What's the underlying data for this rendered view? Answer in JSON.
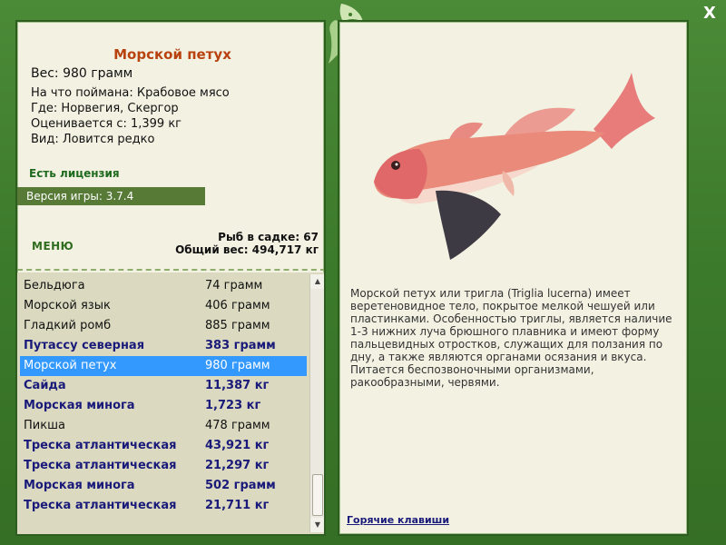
{
  "fish": {
    "title": "Морской петух",
    "weight_line": "Вес: 980 грамм",
    "details": [
      "На что поймана: Крабовое мясо",
      "Где: Норвегия, Скергор",
      "Оценивается с: 1,399 кг",
      "Вид: Ловится редко"
    ],
    "description": "Морской петух или тригла (Triglia lucerna) имеет веретеновидное тело, покрытое мелкой чешуей или пластинками. Особенностью триглы, является наличие 1-3 нижних луча брюшного плавника и имеют форму пальцевидных отростков, служащих для ползания по дну, а также являются органами осязания и вкуса. Питается беспозвоночными организмами, ракообразными, червями."
  },
  "license_text": "Есть лицензия",
  "version_text": "Версия игры: 3.7.4",
  "menu_label": "МЕНЮ",
  "stats": {
    "fish_count": "Рыб в садке: 67",
    "total_weight": "Общий вес: 494,717 кг"
  },
  "catch_list": [
    {
      "name": "Бельдюга",
      "weight": "74 грамм",
      "bold": false,
      "selected": false
    },
    {
      "name": "Морской язык",
      "weight": "406 грамм",
      "bold": false,
      "selected": false
    },
    {
      "name": "Гладкий ромб",
      "weight": "885 грамм",
      "bold": false,
      "selected": false
    },
    {
      "name": "Путассу северная",
      "weight": "383 грамм",
      "bold": true,
      "selected": false
    },
    {
      "name": "Морской петух",
      "weight": "980 грамм",
      "bold": false,
      "selected": true
    },
    {
      "name": "Сайда",
      "weight": "11,387 кг",
      "bold": true,
      "selected": false
    },
    {
      "name": "Морская минога",
      "weight": "1,723 кг",
      "bold": true,
      "selected": false
    },
    {
      "name": "Пикша",
      "weight": "478 грамм",
      "bold": false,
      "selected": false
    },
    {
      "name": "Треска атлантическая",
      "weight": "43,921 кг",
      "bold": true,
      "selected": false
    },
    {
      "name": "Треска атлантическая",
      "weight": "21,297 кг",
      "bold": true,
      "selected": false
    },
    {
      "name": "Морская минога",
      "weight": "502 грамм",
      "bold": true,
      "selected": false
    },
    {
      "name": "Треска атлантическая",
      "weight": "21,711 кг",
      "bold": true,
      "selected": false
    }
  ],
  "hotkeys_label": "Горячие клавиши",
  "close_label": "X",
  "colors": {
    "frame": "#3d7a2c",
    "panel": "#f2f1e2",
    "title": "#b8410e",
    "selected_row": "#3399ff",
    "bold_row": "#1a1a7a",
    "version_bar": "#577a37"
  },
  "icons": {
    "close": "close-icon",
    "ornament": "fish-ornament-icon",
    "scroll_up": "scroll-up-icon",
    "scroll_down": "scroll-down-icon"
  }
}
